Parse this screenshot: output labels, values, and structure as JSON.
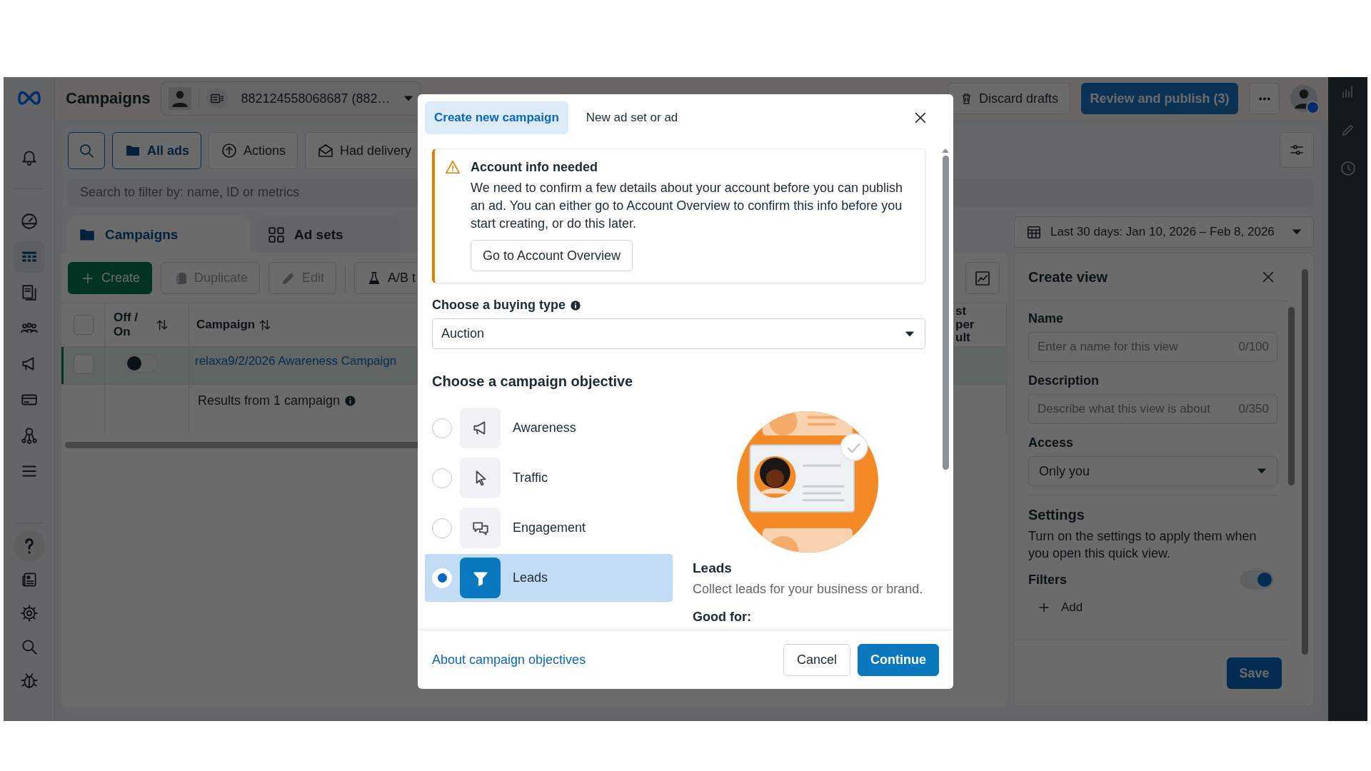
{
  "nav": {
    "top": [
      {
        "kind": "bell",
        "selected": false
      }
    ],
    "main": [
      {
        "kind": "gauge",
        "selected": false
      },
      {
        "kind": "table",
        "selected": true
      },
      {
        "kind": "pages",
        "selected": false
      },
      {
        "kind": "people",
        "selected": false
      },
      {
        "kind": "megaphone",
        "selected": false
      },
      {
        "kind": "card",
        "selected": false
      },
      {
        "kind": "network",
        "selected": false
      },
      {
        "kind": "menu",
        "selected": false
      }
    ],
    "bottom": [
      {
        "kind": "help",
        "selected": false
      },
      {
        "kind": "newspaper",
        "selected": false
      },
      {
        "kind": "gear",
        "selected": false
      },
      {
        "kind": "search",
        "selected": false
      },
      {
        "kind": "bug",
        "selected": false
      }
    ]
  },
  "top_bar": {
    "title": "Campaigns",
    "account": "882124558068687 (882…",
    "discard": "Discard drafts",
    "publish": "Review and publish (3)"
  },
  "toolbar": [
    {
      "kind": "search",
      "selected": true
    },
    {
      "kind": "folder",
      "label": "All ads",
      "selected": true
    },
    {
      "kind": "upload",
      "label": "Actions",
      "selected": false
    },
    {
      "kind": "envelope",
      "label": "Had delivery",
      "selected": false
    }
  ],
  "search": {
    "placeholder": "Search to filter by: name, ID or metrics"
  },
  "level_tabs": [
    {
      "kind": "folder",
      "label": "Campaigns",
      "selected": true
    },
    {
      "kind": "grid",
      "label": "Ad sets",
      "selected": false
    }
  ],
  "date_range": "Last 30 days: Jan 10, 2026 – Feb 8, 2026",
  "actions": [
    {
      "kind": "primary",
      "label": "Create",
      "disabled": false
    },
    {
      "kind": "secondary",
      "label": "Duplicate",
      "disabled": true
    },
    {
      "kind": "secondary",
      "label": "Edit",
      "disabled": true
    },
    {
      "kind": "secondary",
      "label": "A/B t",
      "disabled": false
    }
  ],
  "table": {
    "columns": [
      "Off / On",
      "Campaign",
      "st per ult"
    ],
    "header_checked": false,
    "rows": [
      {
        "checked": false,
        "on": false,
        "selected": true,
        "campaign": "relaxa9/2/2026 Awareness Campaign"
      }
    ],
    "summary": "Results from 1 campaign"
  },
  "create_view": {
    "title": "Create view",
    "fields": [
      {
        "kind": "text",
        "label": "Name",
        "placeholder": "Enter a name for this view",
        "counter": "0/100"
      },
      {
        "kind": "text",
        "label": "Description",
        "placeholder": "Describe what this view is about",
        "counter": "0/350"
      },
      {
        "kind": "select",
        "label": "Access",
        "value": "Only you"
      }
    ],
    "settings_title": "Settings",
    "settings_text": "Turn on the settings to apply them when you open this quick view.",
    "toggles": [
      {
        "label": "Filters",
        "on": true
      }
    ],
    "add": "Add",
    "save": "Save"
  },
  "dialog": {
    "tabs": [
      {
        "label": "Create new campaign",
        "selected": true
      },
      {
        "label": "New ad set or ad",
        "selected": false
      }
    ],
    "alert": {
      "title": "Account info needed",
      "text": "We need to confirm a few details about your account before you can publish an ad. You can either go to Account Overview to confirm this info before you start creating, or do this later.",
      "button": "Go to Account Overview"
    },
    "buying_type": {
      "label": "Choose a buying type",
      "value": "Auction"
    },
    "objective_title": "Choose a campaign objective",
    "objectives": [
      {
        "kind": "megaphone",
        "label": "Awareness",
        "selected": false
      },
      {
        "kind": "pointer",
        "label": "Traffic",
        "selected": false
      },
      {
        "kind": "chat",
        "label": "Engagement",
        "selected": false
      },
      {
        "kind": "funnel",
        "label": "Leads",
        "selected": true
      }
    ],
    "detail": {
      "title": "Leads",
      "text": "Collect leads for your business or brand.",
      "good_for": "Good for:"
    },
    "link": "About campaign objectives",
    "buttons": [
      {
        "kind": "secondary",
        "label": "Cancel"
      },
      {
        "kind": "primary",
        "label": "Continue"
      }
    ]
  }
}
